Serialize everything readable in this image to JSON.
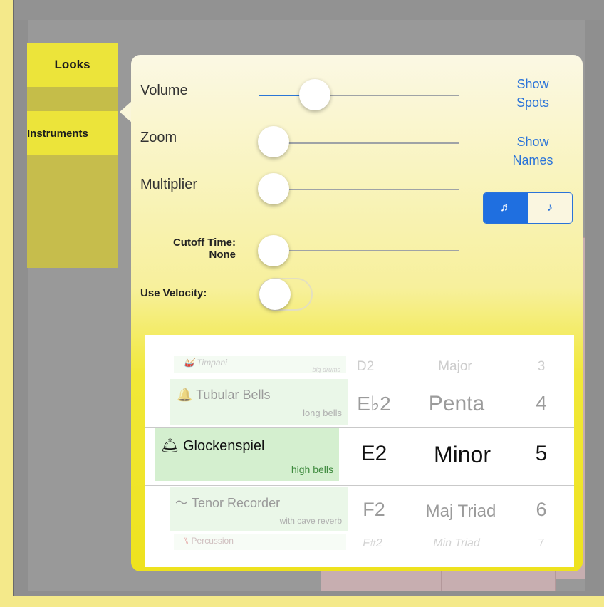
{
  "tabs": [
    {
      "label": "Looks"
    },
    {
      "label": "Instruments"
    }
  ],
  "sliders": {
    "volume": {
      "label": "Volume",
      "value": 0.3
    },
    "zoom": {
      "label": "Zoom",
      "value": 0.0
    },
    "multiplier": {
      "label": "Multiplier",
      "value": 0.0
    },
    "cutoff": {
      "label_line1": "Cutoff Time:",
      "label_line2": "None",
      "value": 0.0
    }
  },
  "velocity": {
    "label": "Use Velocity:",
    "on": false
  },
  "links": {
    "show_spots": {
      "line1": "Show",
      "line2": "Spots"
    },
    "show_names": {
      "line1": "Show",
      "line2": "Names"
    }
  },
  "note_mode": {
    "options": [
      {
        "icon": "♬",
        "name": "beamed-notes-icon",
        "selected": true
      },
      {
        "icon": "♪",
        "name": "single-note-icon",
        "selected": false
      }
    ]
  },
  "picker": {
    "instruments": [
      {
        "icon": "🥁",
        "icon_name": "drum-icon",
        "name": "Timpani",
        "sub": "big drums"
      },
      {
        "icon": "🔔",
        "icon_name": "bell-icon",
        "name": "Tubular Bells",
        "sub": "long bells"
      },
      {
        "icon": "🛎",
        "icon_name": "glockenspiel-bell-icon",
        "name": "Glockenspiel",
        "sub": "high bells"
      },
      {
        "icon": "〜",
        "icon_name": "recorder-icon",
        "name": "Tenor Recorder",
        "sub": "with cave reverb"
      },
      {
        "icon": "⑊",
        "icon_name": "percussion-icon",
        "name": "Percussion",
        "sub": ""
      }
    ],
    "notes": [
      "D2",
      "E♭2",
      "E2",
      "F2",
      "F#2"
    ],
    "scales": [
      "Major",
      "Penta",
      "Minor",
      "Maj Triad",
      "Min Triad"
    ],
    "octaves": [
      "3",
      "4",
      "5",
      "6",
      "7"
    ],
    "selected_index": 2
  }
}
